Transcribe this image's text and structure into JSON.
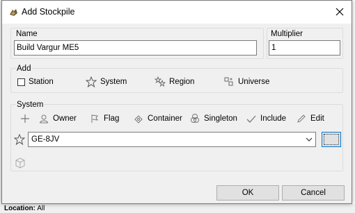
{
  "window": {
    "title": "Add Stockpile"
  },
  "name_group": {
    "label": "Name",
    "value": "Build Vargur ME5"
  },
  "multiplier_group": {
    "label": "Multiplier",
    "value": "1"
  },
  "add_group": {
    "label": "Add",
    "options": [
      "Station",
      "System",
      "Region",
      "Universe"
    ]
  },
  "system_group": {
    "label": "System",
    "toolbar": [
      "Owner",
      "Flag",
      "Container",
      "Singleton",
      "Include",
      "Edit"
    ],
    "selected_system": "GE-8JV"
  },
  "buttons": {
    "ok": "OK",
    "cancel": "Cancel"
  },
  "background": {
    "location_label": "Location:",
    "location_value": "All"
  },
  "colors": {
    "accent_blue": "#0078d7",
    "dialog_bg": "#f0f0f0",
    "titlebar_bg": "#ffffff"
  }
}
